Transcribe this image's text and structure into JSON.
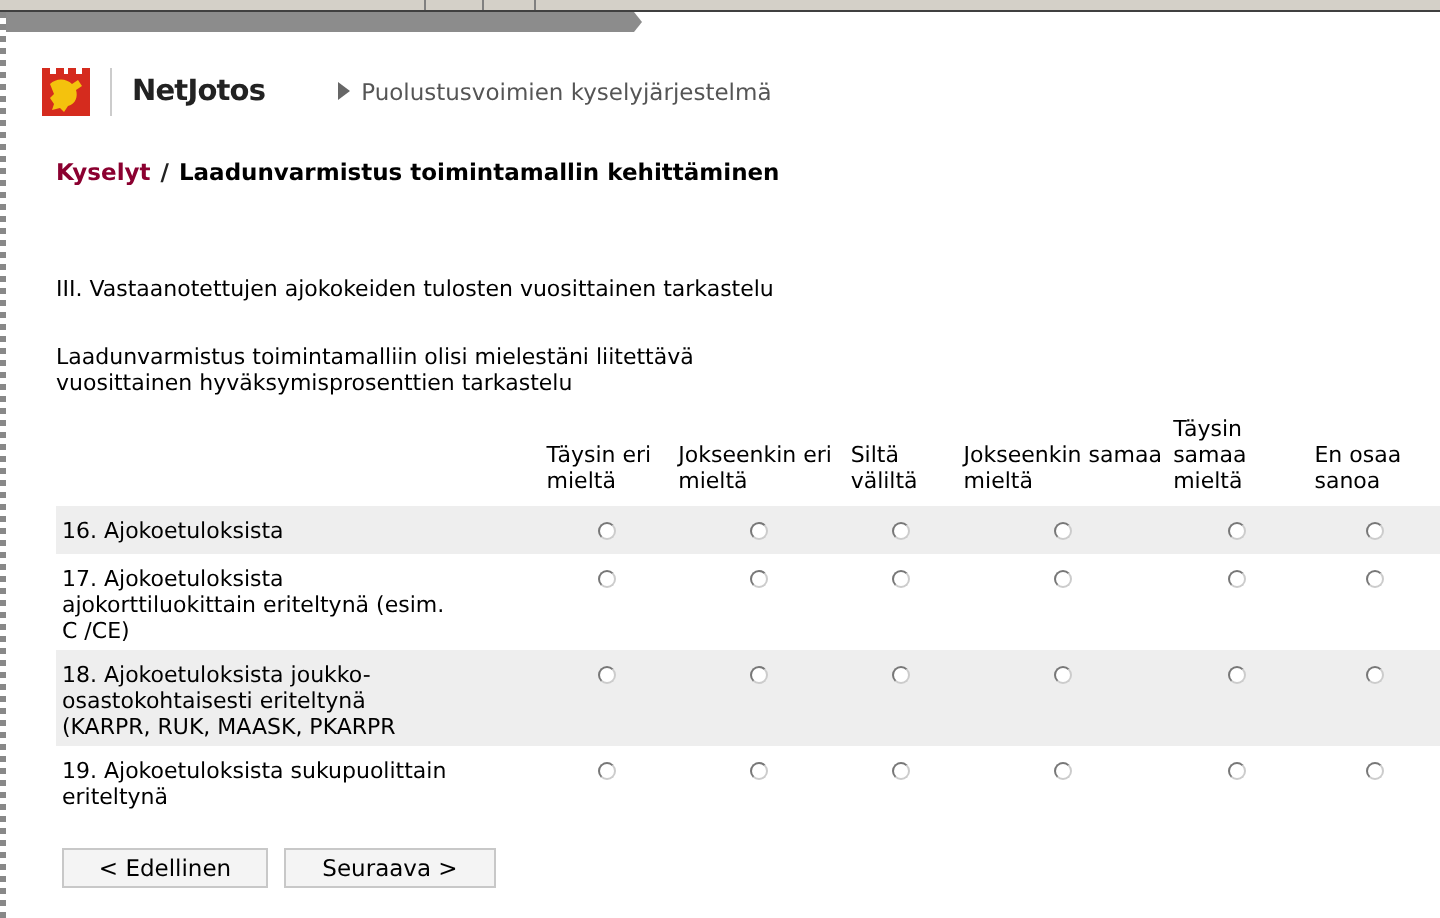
{
  "header": {
    "brand": "NetJotos",
    "system": "Puolustusvoimien kyselyjärjestelmä"
  },
  "breadcrumb": {
    "link": "Kyselyt",
    "separator": "/",
    "current": "Laadunvarmistus toimintamallin kehittäminen"
  },
  "section_title": "III. Vastaanotettujen ajokokeiden tulosten vuosittainen tarkastelu",
  "question": "Laadunvarmistus toimintamalliin olisi mielestäni liitettävä vuosittainen hyväksymisprosenttien tarkastelu",
  "columns": [
    "Täysin eri mieltä",
    "Jokseenkin eri mieltä",
    "Siltä väliltä",
    "Jokseenkin samaa mieltä",
    "Täysin samaa mieltä",
    "En osaa sanoa"
  ],
  "rows": [
    {
      "label": "16. Ajokoetuloksista",
      "options": [
        {
          "selected": false
        },
        {
          "selected": false
        },
        {
          "selected": false
        },
        {
          "selected": false
        },
        {
          "selected": false
        },
        {
          "selected": false
        }
      ]
    },
    {
      "label": "17. Ajokoetuloksista ajokorttiluokittain eriteltynä (esim. C /CE)",
      "options": [
        {
          "selected": false
        },
        {
          "selected": false
        },
        {
          "selected": false
        },
        {
          "selected": false
        },
        {
          "selected": false
        },
        {
          "selected": false
        }
      ]
    },
    {
      "label": "18. Ajokoetuloksista joukko-osastokohtaisesti eriteltynä (KARPR, RUK, MAASK, PKARPR",
      "options": [
        {
          "selected": false
        },
        {
          "selected": false
        },
        {
          "selected": false
        },
        {
          "selected": false
        },
        {
          "selected": false
        },
        {
          "selected": false
        }
      ]
    },
    {
      "label": "19. Ajokoetuloksista sukupuolittain eriteltynä",
      "options": [
        {
          "selected": false
        },
        {
          "selected": false
        },
        {
          "selected": false
        },
        {
          "selected": false
        },
        {
          "selected": false
        },
        {
          "selected": false
        }
      ]
    }
  ],
  "buttons": [
    "< Edellinen",
    "Seuraava >"
  ]
}
